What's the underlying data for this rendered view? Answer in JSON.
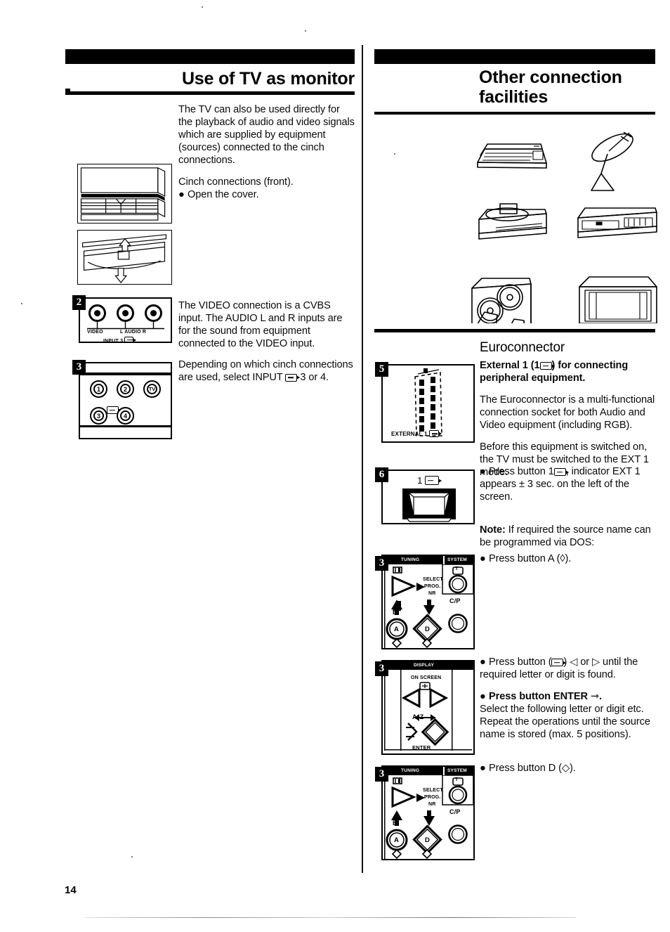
{
  "page": {
    "number": "14"
  },
  "left_column": {
    "title": "Use of TV as monitor",
    "intro": "The TV can also be used directly for the playback of audio and video signals which are supplied by equipment (sources) connected to the cinch connections.",
    "cinch_line": "Cinch connections (front).",
    "cinch_bullet": "Open the cover.",
    "step2_text": "The VIDEO connection is a CVBS input. The AUDIO L and R inputs are for the sound from equipment connected to the VIDEO input.",
    "step3_text_a": "Depending on which cinch connections",
    "step3_text_b": "are used, select INPUT",
    "step3_text_c": "3 or 4.",
    "steps": {
      "two": "2",
      "three": "3"
    },
    "figures": {
      "front_panel_label": "tv-front-cover-closed",
      "cover_open_label": "tv-front-cover-open",
      "jack_labels": {
        "video": "VIDEO",
        "audio": "L  AUDIO  R",
        "input": "INPUT 3"
      },
      "selector_buttons": [
        "1",
        "2",
        "TV",
        "3",
        "4"
      ]
    }
  },
  "right_column": {
    "title_line1": "Other connection",
    "title_line2": "facilities",
    "equipment_icons": [
      "computer-keyboard-icon",
      "satellite-dish-icon",
      "laserdisc-player-icon",
      "vcr-icon",
      "speaker-system-icon",
      "television-icon"
    ],
    "euroconnector": {
      "heading": "Euroconnector",
      "bold_lead_a": "External 1 (1",
      "bold_lead_b": ") for connecting peripheral equipment.",
      "para1": "The Euroconnector is a multi-functional connection socket for both Audio and Video equipment (including RGB).",
      "para2": "Before this equipment is switched on, the TV must be switched to the EXT 1 mode.",
      "scart_label": "EXTERNAL 1"
    },
    "step5": "5",
    "step6": "6",
    "step6_figure_label": "1",
    "step6_text_a": "Press button 1",
    "step6_text_b": ", indicator EXT 1 appears ± 3 sec. on the left of the screen.",
    "note_bold": "Note:",
    "note_text": " If required the source name can be programmed via DOS:",
    "step_a": {
      "badge": "3",
      "text": "Press button A (◊)."
    },
    "step_b": {
      "badge": "3",
      "bullet1_a": "Press button (",
      "bullet1_b": ") ◁ or ▷ until the required letter or digit is found.",
      "bullet2_bold": "Press button ENTER",
      "bullet2_rest": "Select the following letter or digit etc. Repeat the operations until the source name is stored (max. 5 positions)."
    },
    "step_c": {
      "badge": "3",
      "text": "Press button D (◇)."
    },
    "panel_tuning": {
      "header_left": "TUNING",
      "header_right": "SYSTEM",
      "select": "SELECT",
      "prog": "PROG.",
      "nr": "NR",
      "btn_b": "B",
      "btn_a": "A",
      "btn_d": "D",
      "cp": "C/P",
      "sys_t": "T"
    },
    "panel_display": {
      "header": "DISPLAY",
      "on_screen": "ON SCREEN",
      "a_to_z": "A       Z",
      "enter": "ENTER"
    }
  }
}
